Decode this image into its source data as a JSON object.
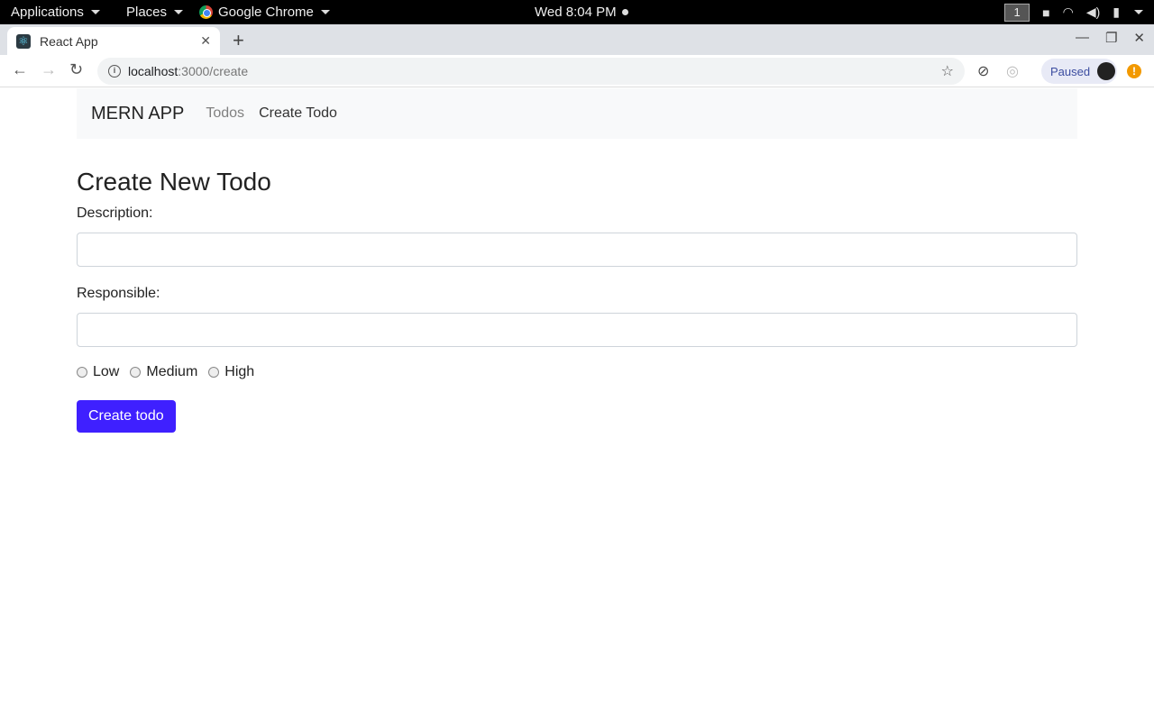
{
  "topbar": {
    "applications": "Applications",
    "places": "Places",
    "app_name": "Google Chrome",
    "clock": "Wed  8:04 PM",
    "workspace": "1"
  },
  "browser": {
    "tab_title": "React App",
    "url_host": "localhost",
    "url_path": ":3000/create",
    "profile_status": "Paused"
  },
  "navbar": {
    "brand": "MERN APP",
    "links": [
      "Todos",
      "Create Todo"
    ]
  },
  "form": {
    "heading": "Create New Todo",
    "description_label": "Description:",
    "description_value": "",
    "responsible_label": "Responsible:",
    "responsible_value": "",
    "priority_options": [
      "Low",
      "Medium",
      "High"
    ],
    "submit_label": "Create todo"
  },
  "colors": {
    "button": "#3f20ff",
    "navbar_bg": "#f8f9fa"
  }
}
